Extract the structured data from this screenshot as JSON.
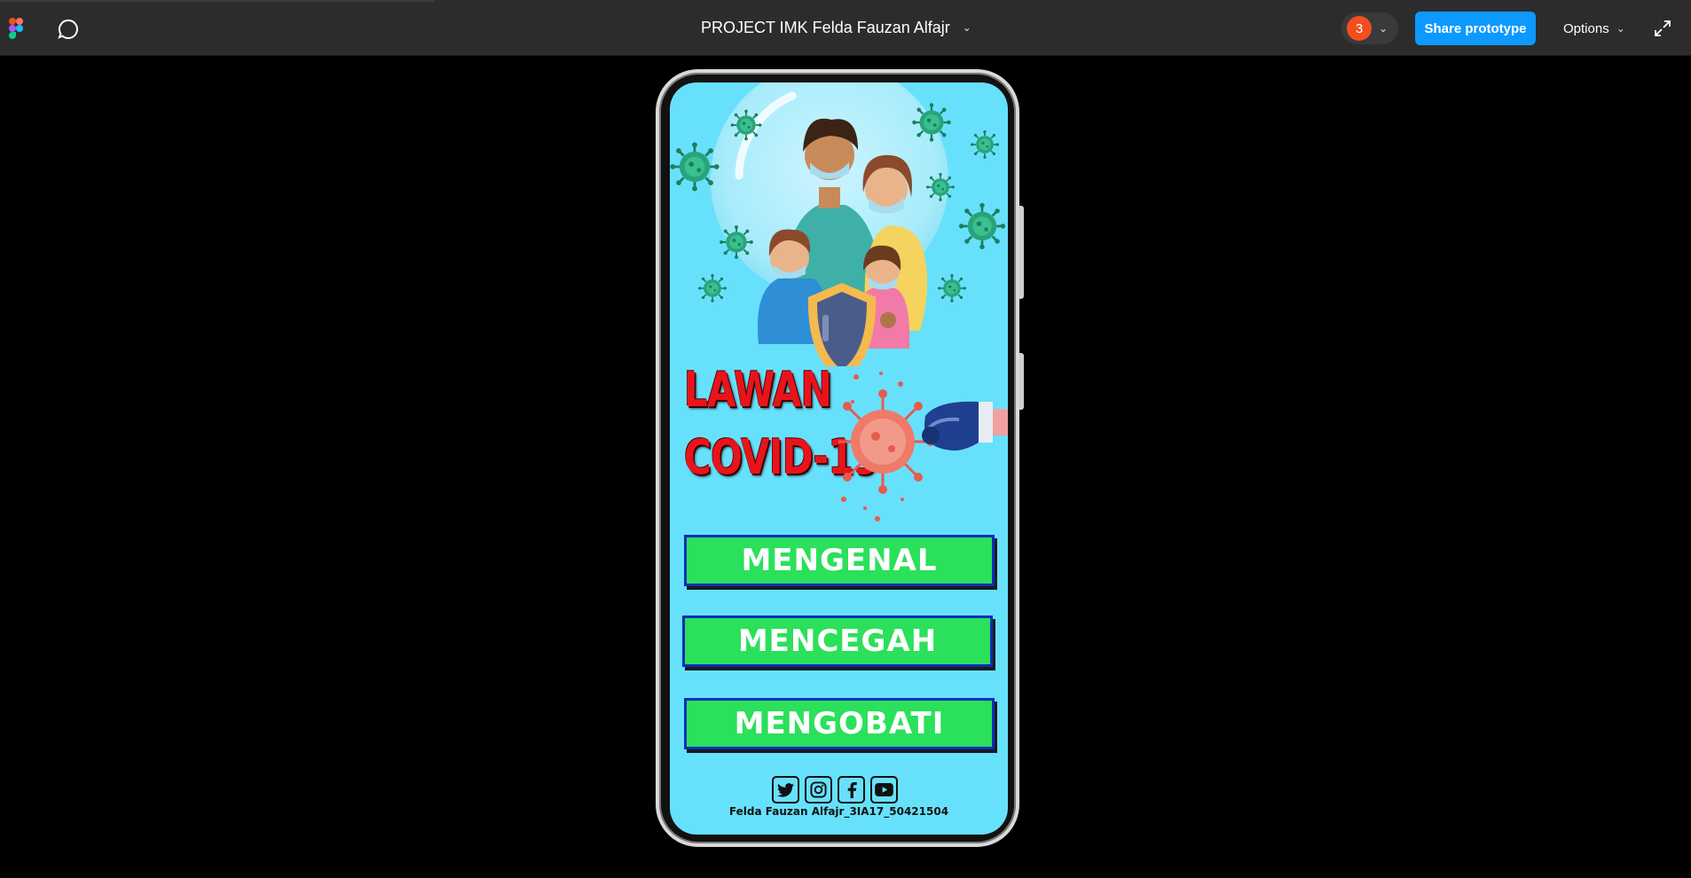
{
  "app": {
    "project_title": "PROJECT IMK Felda Fauzan Alfajr",
    "collaborator_count": "3",
    "share_label": "Share prototype",
    "options_label": "Options"
  },
  "icons": {
    "figma": "figma-logo-icon",
    "comment": "comment-icon",
    "chevron": "chevron-down-icon",
    "expand": "expand-icon",
    "twitter": "twitter-icon",
    "instagram": "instagram-icon",
    "facebook": "facebook-icon",
    "youtube": "youtube-icon"
  },
  "colors": {
    "toolbar_bg": "#2c2c2c",
    "share_blue": "#0d99ff",
    "avatar_orange": "#f24e1e",
    "screen_cyan": "#67e1fb",
    "title_red": "#e8141c",
    "button_green": "#2be05a",
    "button_border": "#0a2dbd"
  },
  "prototype": {
    "title_line1": "LAWAN",
    "title_line2": "COVID-19",
    "buttons": [
      {
        "label": "MENGENAL"
      },
      {
        "label": "MENCEGAH"
      },
      {
        "label": "MENGOBATI"
      }
    ],
    "footer": "Felda Fauzan Alfajr_3IA17_50421504"
  }
}
